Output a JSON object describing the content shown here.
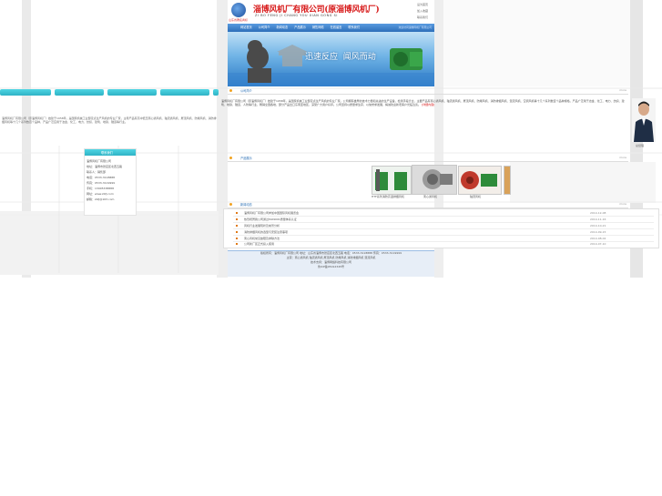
{
  "header": {
    "company_name": "淄博风机厂有限公司(原淄博风机厂)",
    "company_pinyin": "ZI BO FENG JI CHANG YOU XIAN GONG SI",
    "logo_caption": "山东省著名商标",
    "top_links": [
      "设为首页",
      "加入收藏",
      "联系我们"
    ]
  },
  "nav": {
    "items": [
      "网站首页",
      "公司简介",
      "新闻动态",
      "产品展示",
      "销售网络",
      "在线留言",
      "联系我们"
    ],
    "right_text": "欢迎访问淄博风机厂有限公司"
  },
  "banner": {
    "slogan": "迅速反应  闻风而动"
  },
  "left_panel": {
    "text": "淄博风机厂有限公司（原淄博风机厂）始建于1958年，是国家机械工业部定点生产风机的专业厂家，主导产品有高中低压离心通风机、轴流通风机、屋顶风机、防爆风机、消防排烟风机等十几个系列数百个品种，产品广泛应用于冶金、化工、电力、纺织、建筑、地铁、隧道等行业。",
    "contact_title": "联系我们",
    "contact_lines": [
      "淄博风机厂有限公司",
      "地址：淄博市张店区北西五路",
      "联系人：销售部",
      "电话：0533-3118888",
      "传真：0533-3119999",
      "手机：13905338888",
      "网址：www.zbfj.com",
      "邮箱：zbfj@163.com"
    ]
  },
  "intro": {
    "title": "公司简介",
    "more": "more",
    "text": "淄博风机厂有限公司（原淄博风机厂）始建于1958年，是国家机械工业部定点生产风机的专业厂家。公司拥有雄厚的技术力量和先进的生产设备，检测手段齐全，主要产品有离心通风机、轴流通风机、屋顶风机、防爆风机、消防排烟风机、混流风机、空调风机等十几个系列数百个品种规格，产品广泛用于冶金、化工、电力、纺织、建筑、地铁、隧道、人防等行业，畅销全国各地，部分产品出口东南亚地区，深受广大用户好评。公司坚持以质量求生存，以信誉求发展，竭诚欢迎新老客户光临洽谈。",
    "detail_link": "[详细内容]",
    "person_caption": "总经理"
  },
  "products": {
    "title": "产品展示",
    "more": "more",
    "items": [
      {
        "caption": "HTF系列消防高温排烟风机"
      },
      {
        "caption": "离心通风机"
      },
      {
        "caption": "轴流风机"
      }
    ]
  },
  "news": {
    "title": "新闻动态",
    "more": "more",
    "items": [
      {
        "title": "淄博风机厂有限公司参加中国国际风机展览会",
        "date": "2014-12-08"
      },
      {
        "title": "热烈祝贺我公司通过ISO9001质量体系认证",
        "date": "2014-11-16"
      },
      {
        "title": "风机行业发展现状及前景分析",
        "date": "2014-10-21"
      },
      {
        "title": "消防排烟风机的选型与安装注意事项",
        "date": "2014-09-15"
      },
      {
        "title": "离心风机常见故障及排除方法",
        "date": "2014-08-02"
      },
      {
        "title": "公司新厂区正式投入使用",
        "date": "2014-07-10"
      }
    ]
  },
  "footer": {
    "lines": [
      "版权所有：淄博风机厂有限公司  地址：山东省淄博市张店区北西五路  电话：0533-3118888  传真：0533-3119999",
      "主营：离心通风机 轴流通风机 屋顶风机 防爆风机 消防排烟风机 混流风机",
      "技术支持：淄博网络科技有限公司",
      "鲁ICP备05012345号"
    ]
  },
  "colors": {
    "accent": "#2a6fb5",
    "nav": "#3a7fc8",
    "pill": "#38c2d2",
    "title_red": "#d81c1c"
  }
}
